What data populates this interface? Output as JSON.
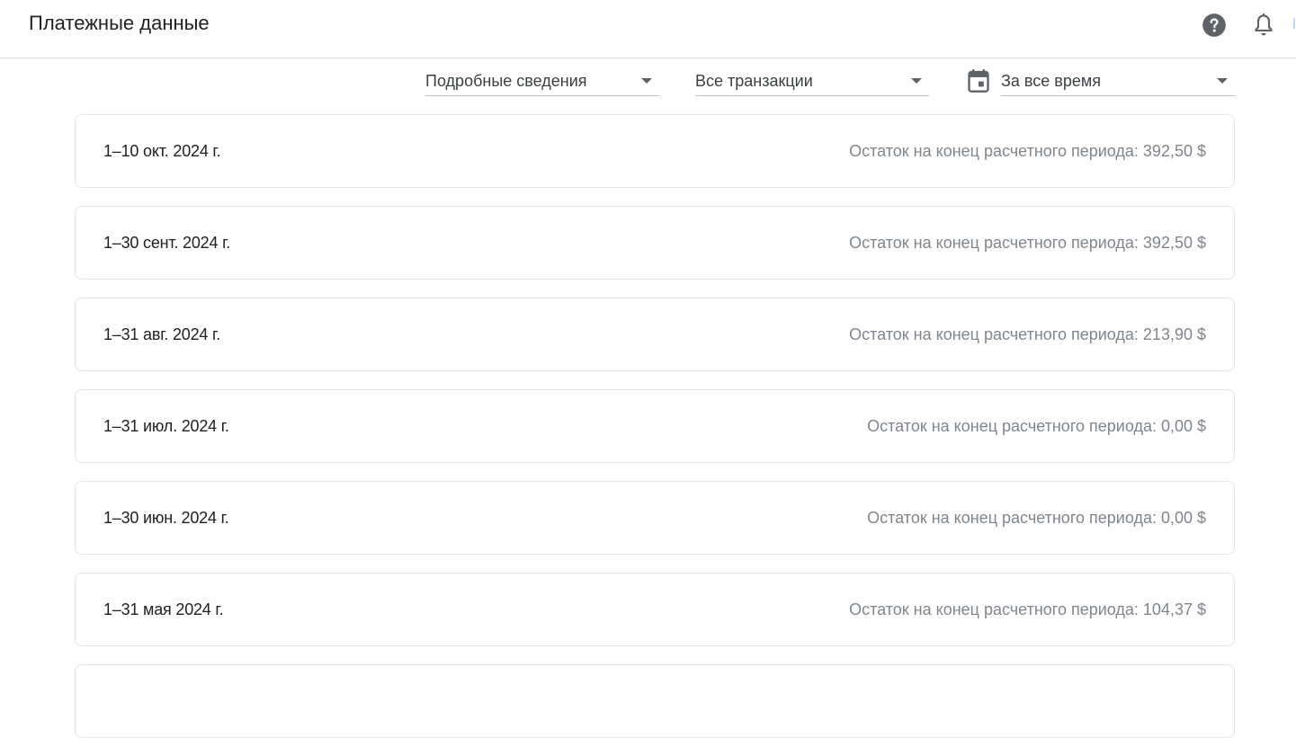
{
  "header": {
    "title": "Платежные данные",
    "icons": [
      "help-icon",
      "bell-icon"
    ]
  },
  "filters": {
    "view": "Подробные сведения",
    "transactions": "Все транзакции",
    "period": "За все время",
    "period_icon": "calendar-icon"
  },
  "periods": [
    {
      "range": "1–10 окт. 2024 г.",
      "balance": "Остаток на конец расчетного периода: 392,50 $"
    },
    {
      "range": "1–30 сент. 2024 г.",
      "balance": "Остаток на конец расчетного периода: 392,50 $"
    },
    {
      "range": "1–31 авг. 2024 г.",
      "balance": "Остаток на конец расчетного периода: 213,90 $"
    },
    {
      "range": "1–31 июл. 2024 г.",
      "balance": "Остаток на конец расчетного периода: 0,00 $"
    },
    {
      "range": "1–30 июн. 2024 г.",
      "balance": "Остаток на конец расчетного периода: 0,00 $"
    },
    {
      "range": "1–31 мая 2024 г.",
      "balance": "Остаток на конец расчетного периода: 104,37 $"
    }
  ],
  "colors": {
    "text_primary": "#202124",
    "text_secondary": "#80868b",
    "icon": "#5f6368",
    "border": "#e3e5e8"
  }
}
